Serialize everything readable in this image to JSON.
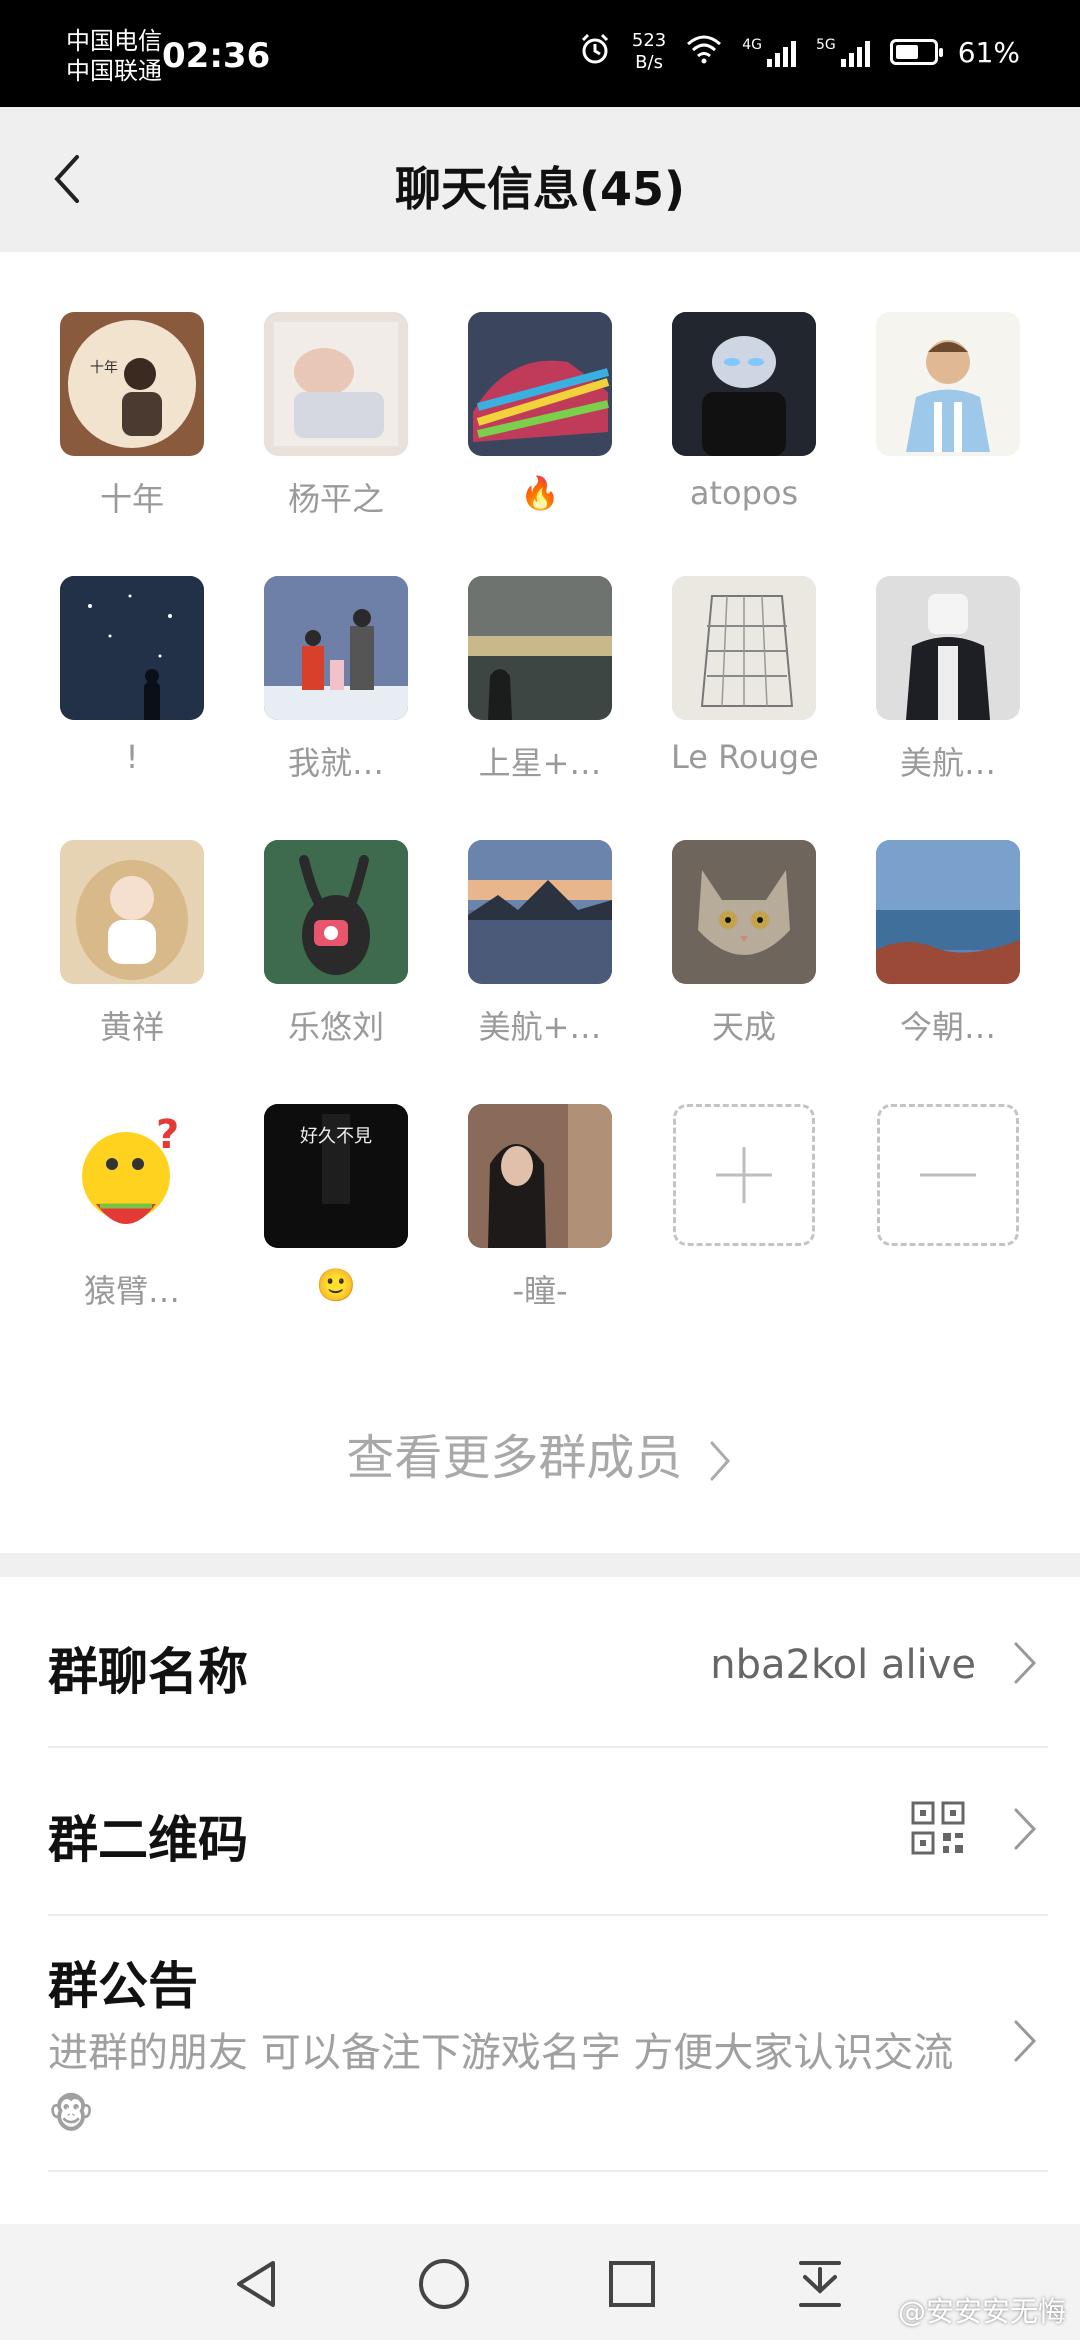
{
  "status_bar": {
    "carrier_1": "中国电信",
    "carrier_2": "中国联通",
    "time": "02:36",
    "net_speed_value": "523",
    "net_speed_unit": "B/s",
    "signal_1_label": "4G",
    "signal_2_label": "5G",
    "battery": "61%",
    "battery_level": 0.61
  },
  "header": {
    "title": "聊天信息(45)"
  },
  "members": [
    {
      "name": "十年",
      "avatar_color": "#8a5a3c",
      "avatar_icon": "portrait-logo-icon"
    },
    {
      "name": "杨平之",
      "avatar_color": "#e9e1dc",
      "avatar_icon": "sleeping-baby-icon"
    },
    {
      "name": "🔥",
      "avatar_color": "#4a5d8c",
      "avatar_icon": "colorful-car-icon"
    },
    {
      "name": "atopos",
      "avatar_color": "#2b3340",
      "avatar_icon": "ultraman-icon"
    },
    {
      "name": "",
      "avatar_color": "#f4f0ea",
      "avatar_icon": "footballer-icon"
    },
    {
      "name": "!",
      "avatar_color": "#2a3a55",
      "avatar_icon": "night-sky-icon"
    },
    {
      "name": "我就…",
      "avatar_color": "#6b7ea8",
      "avatar_icon": "family-photo-icon"
    },
    {
      "name": "上星+…",
      "avatar_color": "#5a6060",
      "avatar_icon": "sea-view-icon"
    },
    {
      "name": "Le Rouge…",
      "avatar_color": "#d8d4cc",
      "avatar_icon": "sketch-icon"
    },
    {
      "name": "美航…",
      "avatar_color": "#d9d9d9",
      "avatar_icon": "person-icon"
    },
    {
      "name": "黄祥",
      "avatar_color": "#e8d5b8",
      "avatar_icon": "baby-icon"
    },
    {
      "name": "乐悠刘",
      "avatar_color": "#3f6a4a",
      "avatar_icon": "cartoon-rabbit-icon"
    },
    {
      "name": "美航+…",
      "avatar_color": "#5b6f8f",
      "avatar_icon": "lake-sunset-icon"
    },
    {
      "name": "天成",
      "avatar_color": "#8a8075",
      "avatar_icon": "cat-icon"
    },
    {
      "name": "今朝…",
      "avatar_color": "#5e86b8",
      "avatar_icon": "seashore-icon"
    },
    {
      "name": "猿臂…",
      "avatar_color": "#ffffff",
      "avatar_icon": "thinking-emoji-icon"
    },
    {
      "name": "🙂",
      "avatar_color": "#0e0e0e",
      "avatar_icon": "dark-text-icon",
      "avatar_text": "好久不見"
    },
    {
      "name": "-瞳-",
      "avatar_color": "#5a4a45",
      "avatar_icon": "girl-street-icon"
    }
  ],
  "actions": {
    "add": "add-member-icon",
    "remove": "remove-member-icon"
  },
  "more_members": "查看更多群成员",
  "settings": {
    "group_name_label": "群聊名称",
    "group_name_value": "nba2kol alive",
    "qr_label": "群二维码",
    "notice_label": "群公告",
    "notice_text": "进群的朋友  可以备注下游戏名字  方便大家认识交流🐵"
  },
  "nav": {
    "back": "back-triangle-icon",
    "home": "home-circle-icon",
    "recents": "recents-square-icon",
    "pull_down": "pull-down-icon"
  },
  "watermark": "@安安安无悔"
}
